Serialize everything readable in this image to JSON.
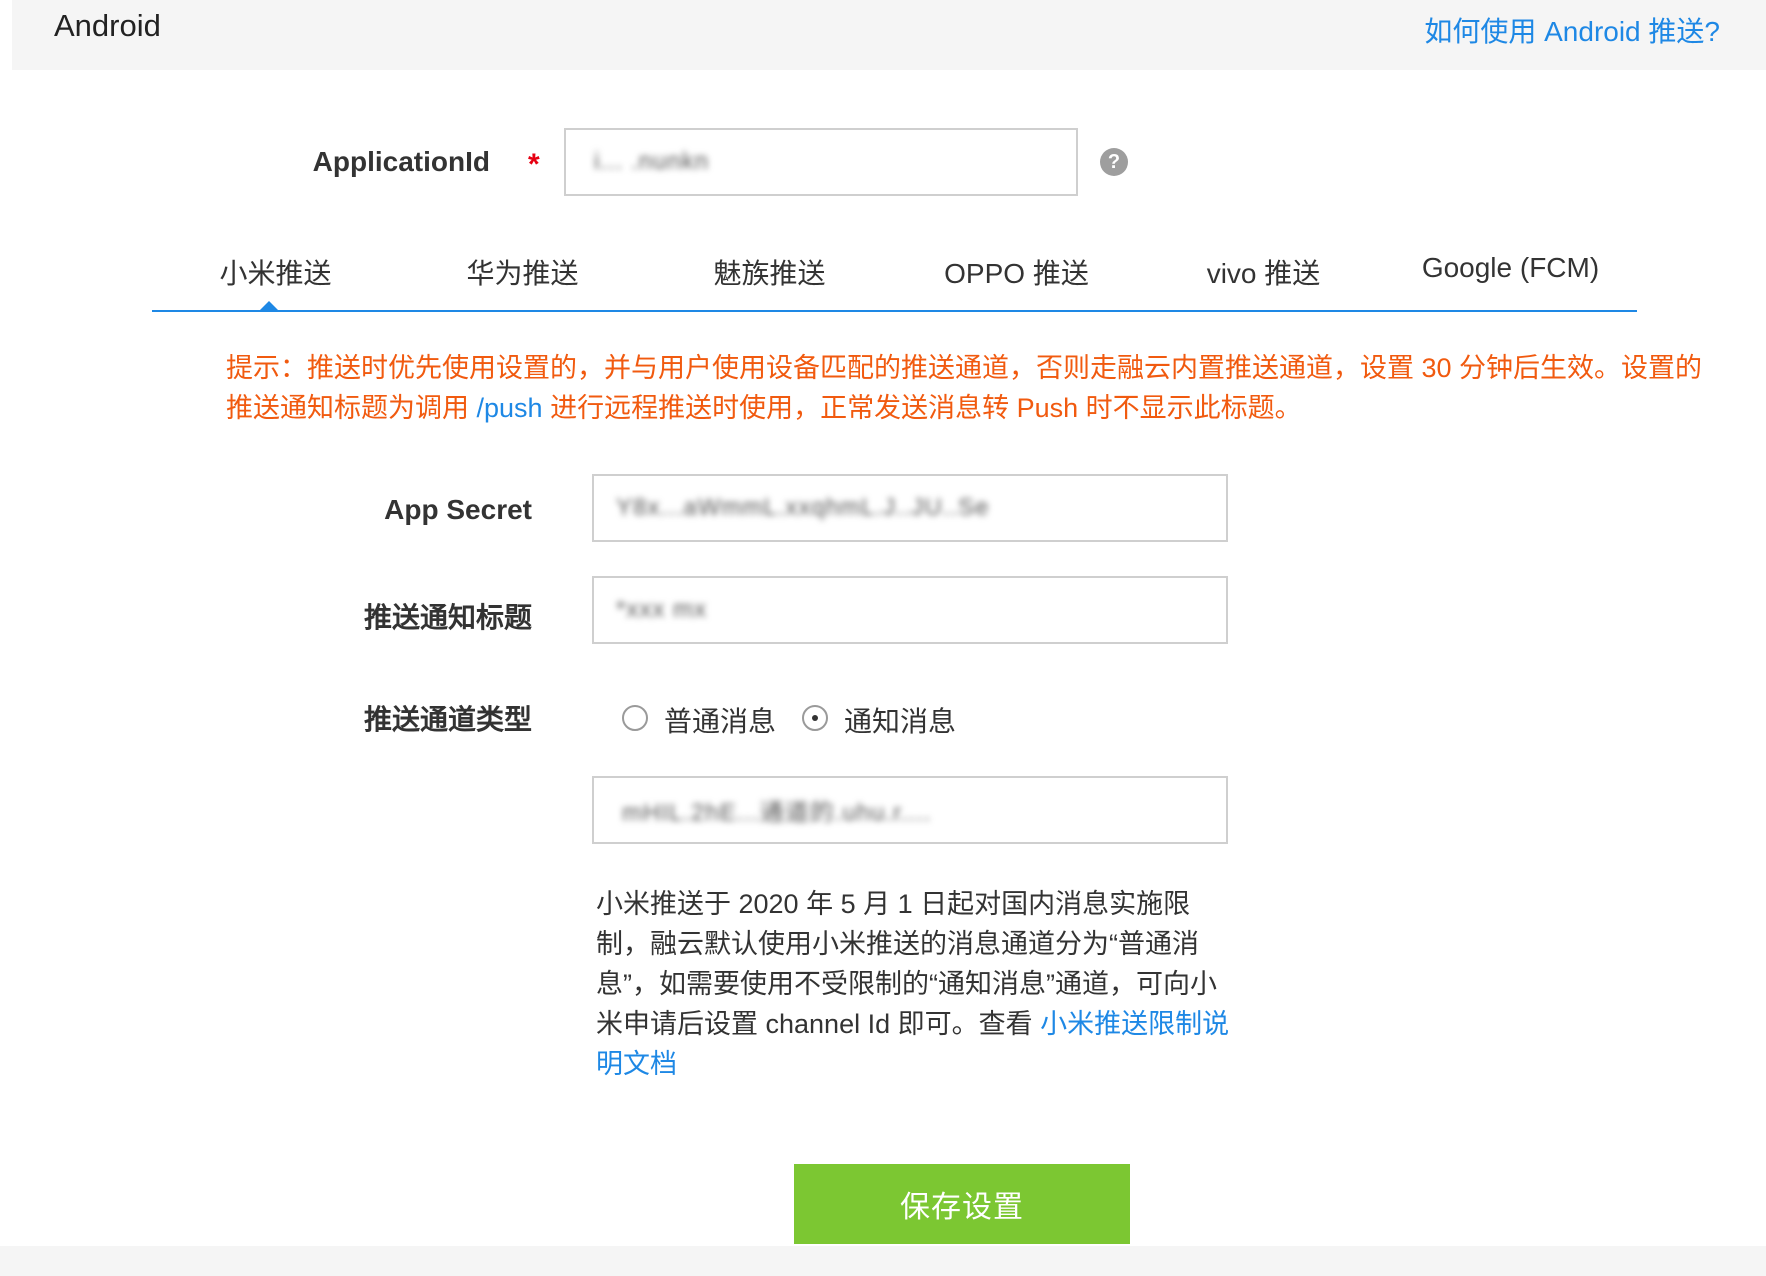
{
  "header": {
    "title": "Android",
    "help_link": "如何使用 Android 推送?"
  },
  "application_id": {
    "label": "ApplicationId",
    "required_mark": "*",
    "value": "i... .nunkn",
    "help_icon": "question-circle-icon"
  },
  "tabs": [
    {
      "label": "小米推送",
      "active": true
    },
    {
      "label": "华为推送",
      "active": false
    },
    {
      "label": "魅族推送",
      "active": false
    },
    {
      "label": "OPPO 推送",
      "active": false
    },
    {
      "label": "vivo 推送",
      "active": false
    },
    {
      "label": "Google (FCM)",
      "active": false
    }
  ],
  "notice": {
    "before_link": "提示：推送时优先使用设置的，并与用户使用设备匹配的推送通道，否则走融云内置推送通道，设置 30 分钟后生效。设置的推送通知标题为调用 ",
    "link": "/push",
    "after_link": " 进行远程推送时使用，正常发送消息转 Push 时不显示此标题。"
  },
  "form": {
    "app_secret": {
      "label": "App Secret",
      "value": "Y8x...aWmmL.xxqhmL.J..JU..Se"
    },
    "notify_title": {
      "label": "推送通知标题",
      "value": "*xxx mx"
    },
    "channel_type": {
      "label": "推送通道类型",
      "options": [
        {
          "label": "普通消息",
          "checked": false
        },
        {
          "label": "通知消息",
          "checked": true
        }
      ]
    },
    "channel_id": {
      "value": "mHIL.2hE...通道的.uhu.r...."
    }
  },
  "description": {
    "text": "小米推送于 2020 年 5 月 1 日起对国内消息实施限制，融云默认使用小米推送的消息通道分为“普通消息”，如需要使用不受限制的“通知消息”通道，可向小米申请后设置 channel Id 即可。查看 ",
    "link": "小米推送限制说明文档"
  },
  "save_button": "保存设置",
  "colors": {
    "accent": "#1e88e5",
    "warning": "#f15a0f",
    "required": "#e60012",
    "save": "#7cc732"
  }
}
